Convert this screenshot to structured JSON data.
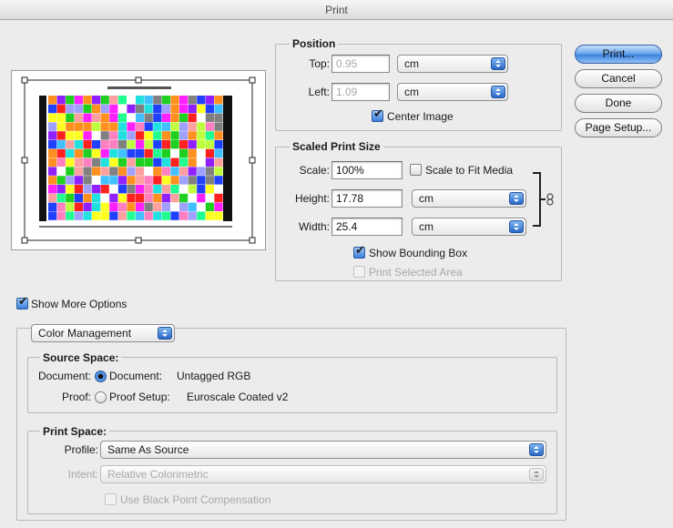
{
  "window": {
    "title": "Print"
  },
  "buttons": {
    "print": "Print...",
    "cancel": "Cancel",
    "done": "Done",
    "page_setup": "Page Setup..."
  },
  "position": {
    "title": "Position",
    "top_label": "Top:",
    "top_value": "0.95",
    "top_unit": "cm",
    "left_label": "Left:",
    "left_value": "1.09",
    "left_unit": "cm",
    "center_label": "Center Image"
  },
  "scaled": {
    "title": "Scaled Print Size",
    "scale_label": "Scale:",
    "scale_value": "100%",
    "fit_label": "Scale to Fit Media",
    "height_label": "Height:",
    "height_value": "17.78",
    "height_unit": "cm",
    "width_label": "Width:",
    "width_value": "25.4",
    "width_unit": "cm",
    "bbox_label": "Show Bounding Box",
    "selected_label": "Print Selected Area"
  },
  "more_options_label": "Show More Options",
  "color_mgmt": {
    "popup": "Color Management"
  },
  "source_space": {
    "title": "Source Space:",
    "document_label": "Document:",
    "document_option": "Document:",
    "document_value": "Untagged RGB",
    "proof_label": "Proof:",
    "proof_option": "Proof Setup:",
    "proof_value": "Euroscale Coated v2"
  },
  "print_space": {
    "title": "Print Space:",
    "profile_label": "Profile:",
    "profile_value": "Same As Source",
    "intent_label": "Intent:",
    "intent_value": "Relative Colorimetric",
    "bpc_label": "Use Black Point Compensation"
  },
  "colors": {
    "accent": "#3a7fdc",
    "window_bg": "#ececec"
  }
}
